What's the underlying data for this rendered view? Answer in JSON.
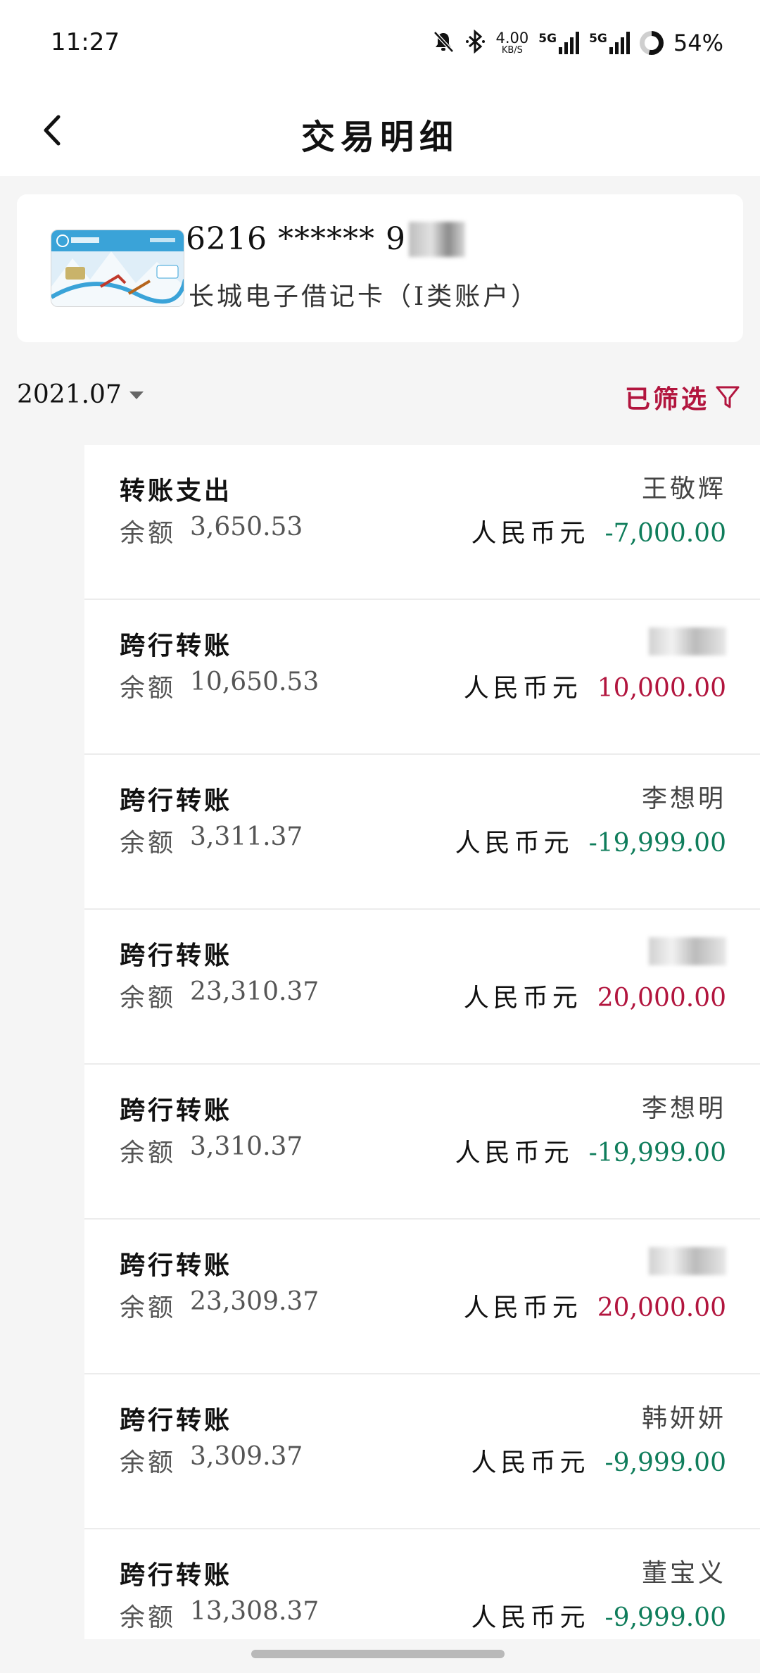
{
  "status_bar": {
    "time": "11:27",
    "speed_value": "4.00",
    "speed_unit": "KB/S",
    "network1": "5G",
    "network2": "5G",
    "battery": "54%"
  },
  "header": {
    "title": "交易明细"
  },
  "card": {
    "number": "6216 ****** 9",
    "name": "长城电子借记卡（I类账户）"
  },
  "filter": {
    "month": "2021.07",
    "filtered_label": "已筛选"
  },
  "transactions": [
    {
      "type": "转账支出",
      "balance_label": "余额",
      "balance": "3,650.53",
      "party": "王敬辉",
      "currency": "人民币元",
      "amount": "-7,000.00",
      "direction": "neg"
    },
    {
      "type": "跨行转账",
      "balance_label": "余额",
      "balance": "10,650.53",
      "party": "",
      "currency": "人民币元",
      "amount": "10,000.00",
      "direction": "pos"
    },
    {
      "type": "跨行转账",
      "balance_label": "余额",
      "balance": "3,311.37",
      "party": "李想明",
      "currency": "人民币元",
      "amount": "-19,999.00",
      "direction": "neg"
    },
    {
      "type": "跨行转账",
      "balance_label": "余额",
      "balance": "23,310.37",
      "party": "",
      "currency": "人民币元",
      "amount": "20,000.00",
      "direction": "pos"
    },
    {
      "type": "跨行转账",
      "balance_label": "余额",
      "balance": "3,310.37",
      "party": "李想明",
      "currency": "人民币元",
      "amount": "-19,999.00",
      "direction": "neg"
    },
    {
      "type": "跨行转账",
      "balance_label": "余额",
      "balance": "23,309.37",
      "party": "",
      "currency": "人民币元",
      "amount": "20,000.00",
      "direction": "pos"
    },
    {
      "type": "跨行转账",
      "balance_label": "余额",
      "balance": "3,309.37",
      "party": "韩妍妍",
      "currency": "人民币元",
      "amount": "-9,999.00",
      "direction": "neg"
    },
    {
      "type": "跨行转账",
      "balance_label": "余额",
      "balance": "13,308.37",
      "party": "董宝义",
      "currency": "人民币元",
      "amount": "-9,999.00",
      "direction": "neg"
    }
  ],
  "colors": {
    "accent": "#b2153e",
    "negative": "#0f7d5b",
    "positive": "#b2153e"
  }
}
